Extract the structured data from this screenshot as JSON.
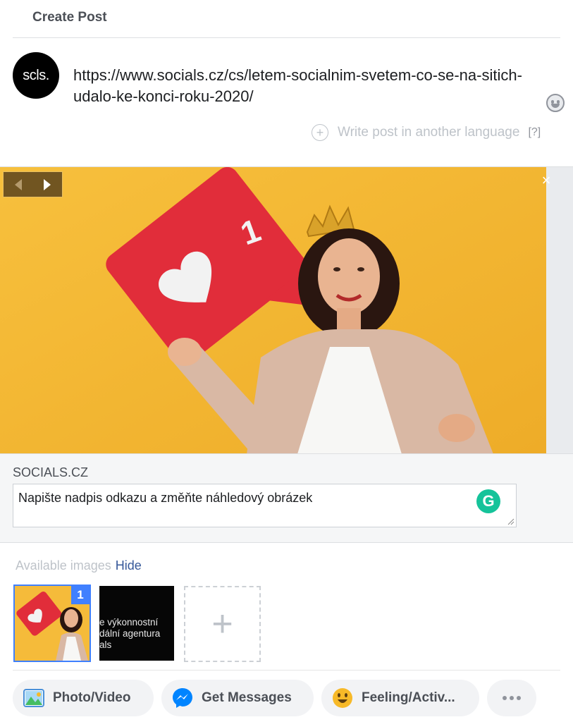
{
  "header": {
    "title": "Create Post"
  },
  "composer": {
    "avatar_text": "scls.",
    "post_text": "https://www.socials.cz/cs/letem-socialnim-svetem-co-se-na-sitich-udalo-ke-konci-roku-2020/",
    "emoji_icon": "smiley-icon",
    "write_language": {
      "plus": "+",
      "label": "Write post in another language",
      "help": "[?]"
    }
  },
  "preview": {
    "like_count": "1",
    "close_label": "×",
    "nav": {
      "prev_icon": "chevron-left-icon",
      "next_icon": "chevron-right-icon"
    }
  },
  "link": {
    "domain": "SOCIALS.CZ",
    "caption": "Napište nadpis odkazu a změňte náhledový obrázek",
    "grammarly_letter": "G"
  },
  "available_images": {
    "label": "Available images",
    "hide_label": "Hide",
    "thumbs": [
      {
        "badge": "1",
        "selected": true
      },
      {
        "text": "e výkonnostní\ndální agentura\nals"
      },
      {
        "add_label": "+"
      }
    ]
  },
  "actions": [
    {
      "label": "Photo/Video",
      "icon": "photo-icon"
    },
    {
      "label": "Get Messages",
      "icon": "messenger-icon"
    },
    {
      "label": "Feeling/Activ...",
      "icon": "feeling-emoji-icon"
    }
  ],
  "colors": {
    "accent": "#4080ff",
    "link": "#365899",
    "grammarly": "#15c39a",
    "preview_bg": "#f3b73a",
    "like_red": "#e12d3a"
  }
}
